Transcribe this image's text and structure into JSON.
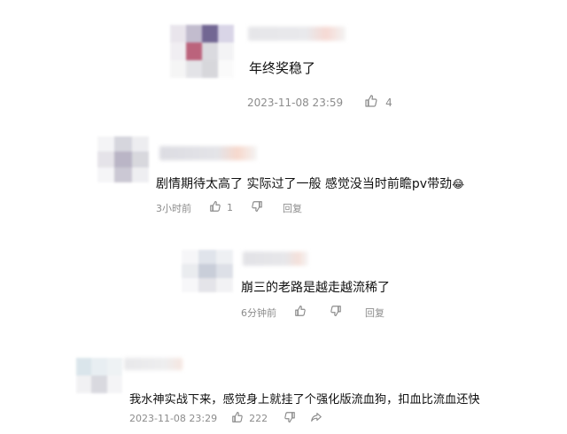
{
  "comments": [
    {
      "text": "年终奖稳了",
      "time": "2023-11-08 23:59",
      "likes": "4",
      "reply": ""
    },
    {
      "text": "剧情期待太高了 实际过了一般 感觉没当时前瞻pv带劲",
      "emoji": "😂",
      "time": "3小时前",
      "likes": "1",
      "reply": "回复"
    },
    {
      "text": "崩三的老路是越走越流稀了",
      "time": "6分钟前",
      "likes": "",
      "reply": "回复"
    },
    {
      "text": "我水神实战下来，感觉身上就挂了个强化版流血狗，扣血比流血还快",
      "time": "2023-11-08 23:29",
      "likes": "222",
      "reply": ""
    }
  ],
  "colors": {
    "text": "#111111",
    "meta": "#8c8c8c",
    "icon": "#8c8c8c"
  }
}
